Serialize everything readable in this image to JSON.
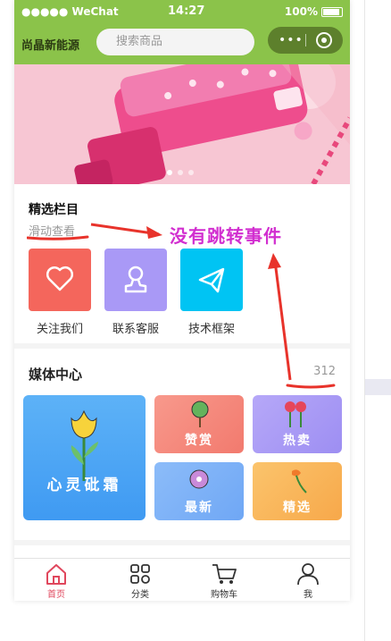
{
  "status_bar": {
    "carrier": "●●●●● WeChat",
    "time": "14:27",
    "battery": "100%"
  },
  "nav": {
    "brand": "尚晶新能源",
    "search_placeholder": "搜索商品"
  },
  "section_featured": {
    "title": "精选栏目",
    "subtitle": "滑动查看",
    "items": [
      {
        "label": "关注我们",
        "icon": "heart-icon",
        "color": "#f4665c"
      },
      {
        "label": "联系客服",
        "icon": "stamp-icon",
        "color": "#a999f6"
      },
      {
        "label": "技术框架",
        "icon": "paper-plane-icon",
        "color": "#00c4f3"
      }
    ]
  },
  "annotation": {
    "text": "没有跳转事件",
    "color": "#d22fd0"
  },
  "section_media": {
    "title": "媒体中心",
    "count": "312",
    "big_card": {
      "label": "心灵砒霜",
      "color": "#4aa6f5"
    },
    "cards": [
      {
        "label": "赞赏",
        "color": "#f7897a"
      },
      {
        "label": "热卖",
        "color": "#a999f6"
      },
      {
        "label": "最新",
        "color": "#7ab3f8"
      },
      {
        "label": "精选",
        "color": "#f9b75a"
      }
    ]
  },
  "tabbar": [
    {
      "label": "首页",
      "icon": "home-icon",
      "active": true
    },
    {
      "label": "分类",
      "icon": "category-icon",
      "active": false
    },
    {
      "label": "购物车",
      "icon": "cart-icon",
      "active": false
    },
    {
      "label": "我",
      "icon": "user-icon",
      "active": false
    }
  ]
}
